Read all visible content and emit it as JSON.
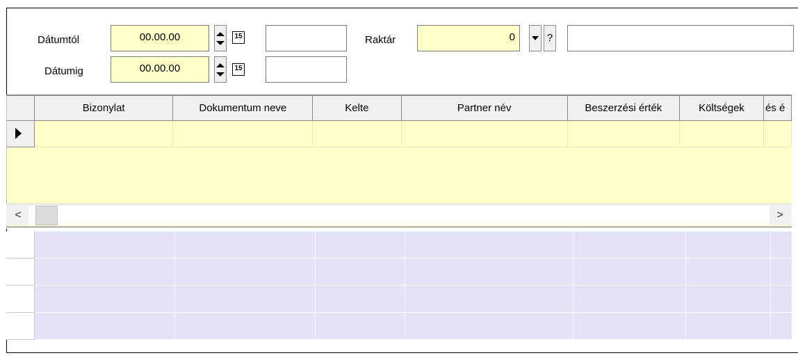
{
  "filters": {
    "datumtol_label": "Dátumtól",
    "datumtol_value": "00.00.00",
    "datumig_label": "Dátumig",
    "datumig_value": "00.00.00",
    "raktar_label": "Raktár",
    "raktar_value": "0",
    "lookup_label": "?",
    "calendar_label": "15"
  },
  "grid": {
    "columns": [
      "Bizonylat",
      "Dokumentum neve",
      "Kelte",
      "Partner név",
      "Beszerzési érték",
      "Költségek",
      "és é"
    ]
  },
  "scrollbar": {
    "left_arrow": "<",
    "right_arrow": ">"
  }
}
